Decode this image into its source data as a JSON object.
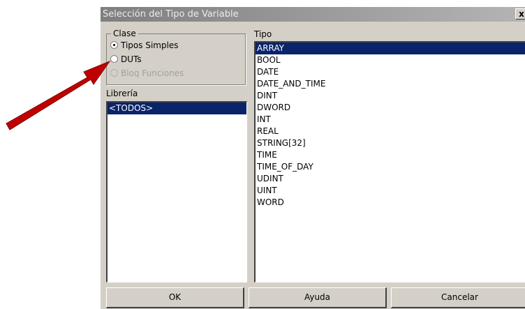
{
  "dialog": {
    "title": "Selección del Tipo de Variable",
    "close_label": "x"
  },
  "clase": {
    "legend": "Clase",
    "options": [
      {
        "label": "Tipos Simples",
        "checked": true,
        "enabled": true
      },
      {
        "label": "DUTs",
        "checked": false,
        "enabled": true
      },
      {
        "label": "Bloq Funciones",
        "checked": false,
        "enabled": false
      }
    ]
  },
  "libreria": {
    "label": "Librería",
    "items": [
      "<TODOS>"
    ],
    "selected": 0
  },
  "tipo": {
    "label": "Tipo",
    "items": [
      "ARRAY",
      "BOOL",
      "DATE",
      "DATE_AND_TIME",
      "DINT",
      "DWORD",
      "INT",
      "REAL",
      "STRING[32]",
      "TIME",
      "TIME_OF_DAY",
      "UDINT",
      "UINT",
      "WORD"
    ],
    "selected": 0
  },
  "buttons": {
    "ok": "OK",
    "help": "Ayuda",
    "cancel": "Cancelar"
  },
  "colors": {
    "arrow": "#c00000",
    "selection": "#0a246a",
    "face": "#d4d0c8"
  }
}
